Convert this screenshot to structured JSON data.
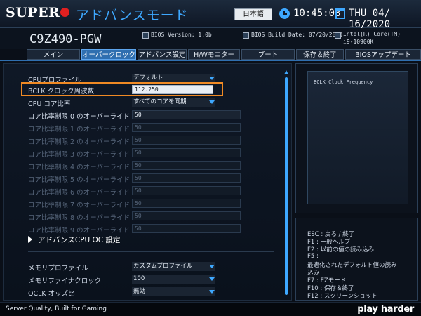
{
  "header": {
    "logo_text": "SUPER",
    "mode_title": "アドバンスモード",
    "language_button": "日本語",
    "time": "10:45:08",
    "date": "THU 04/ 16/2020",
    "accent_color": "#3ea8ff"
  },
  "system": {
    "model": "C9Z490-PGW",
    "bios_version": "BIOS Version: 1.0b",
    "bios_build_date": "BIOS Build Date: 07/20/2020",
    "cpu_line1": "Intel(R) Core(TM)",
    "cpu_line2": "i9-10900K"
  },
  "tabs": [
    {
      "label": "メイン"
    },
    {
      "label": "オーバークロック",
      "active": true
    },
    {
      "label": "アドバンス設定"
    },
    {
      "label": "H/Wモニター"
    },
    {
      "label": "ブート"
    },
    {
      "label": "保存＆終了"
    },
    {
      "label": "BIOSアップデート"
    }
  ],
  "settings": {
    "cpu_profile": {
      "label": "CPUプロファイル",
      "value": "デフォルト"
    },
    "bclk": {
      "label": "BCLK クロック周波数",
      "value": "112.250"
    },
    "cpu_core_ratio": {
      "label": "CPU コア比率",
      "value": "すべてのコアを同期"
    },
    "core_limits": [
      {
        "label": "コア比率制限 0 のオーバーライド",
        "value": "50"
      },
      {
        "label": "コア比率制限 1 のオーバーライド",
        "value": "50"
      },
      {
        "label": "コア比率制限 2 のオーバーライド",
        "value": "50"
      },
      {
        "label": "コア比率制限 3 のオーバーライド",
        "value": "50"
      },
      {
        "label": "コア比率制限 4 のオーバーライド",
        "value": "50"
      },
      {
        "label": "コア比率制限 5 のオーバーライド",
        "value": "50"
      },
      {
        "label": "コア比率制限 6 のオーバーライド",
        "value": "50"
      },
      {
        "label": "コア比率制限 7 のオーバーライド",
        "value": "50"
      },
      {
        "label": "コア比率制限 8 のオーバーライド",
        "value": "50"
      },
      {
        "label": "コア比率制限 9 のオーバーライド",
        "value": "50"
      }
    ],
    "advanced_cpu_oc": "アドバンスCPU OC 設定",
    "memory_profile": {
      "label": "メモリプロファイル",
      "value": "カスタムプロファイル"
    },
    "memory_fine_clock": {
      "label": "メモリファイナクロック",
      "value": "100"
    },
    "qclk_odd": {
      "label": "QCLK オッズ比",
      "value": "無効"
    }
  },
  "help": {
    "text": "BCLK Clock Frequency"
  },
  "keys": [
    "ESC : 戻る / 終了",
    "F1  : 一般ヘルプ",
    "F2  : 以前の値の読み込み",
    "F5  :",
    "最適化されたデフォルト値の読み",
    "込み",
    "F7  : EZモード",
    "F10 : 保存＆終了",
    "F12 : スクリーンショット"
  ],
  "footer": {
    "tagline": "Server Quality, Built for Gaming",
    "brand": "play harder"
  }
}
